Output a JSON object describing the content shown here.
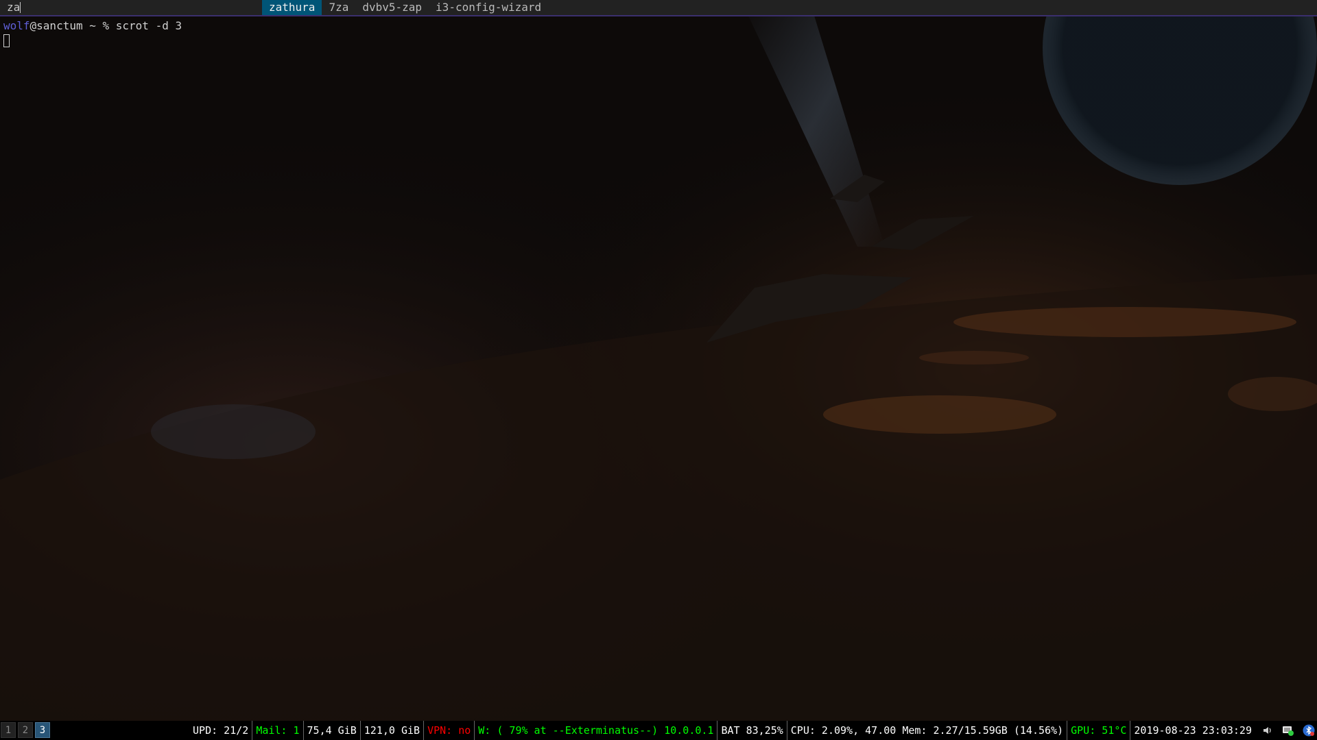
{
  "dmenu": {
    "input": "za",
    "items": [
      {
        "label": "zathura",
        "selected": true
      },
      {
        "label": "7za",
        "selected": false
      },
      {
        "label": "dvbv5-zap",
        "selected": false
      },
      {
        "label": "i3-config-wizard",
        "selected": false
      }
    ]
  },
  "terminal": {
    "user": "wolf",
    "host_part": "@sanctum ~ % ",
    "command": "scrot -d 3"
  },
  "i3bar": {
    "workspaces": [
      {
        "label": "1",
        "focused": false
      },
      {
        "label": "2",
        "focused": false
      },
      {
        "label": "3",
        "focused": true
      }
    ],
    "status": {
      "updates": "UPD: 21/2",
      "mail": "Mail: 1",
      "disk1": "75,4 GiB",
      "disk2": "121,0 GiB",
      "vpn": "VPN: no",
      "wifi": "W: ( 79% at --Exterminatus--) 10.0.0.1",
      "battery": "BAT 83,25%",
      "cpu_mem": "CPU: 2.09%, 47.00 Mem: 2.27/15.59GB (14.56%)",
      "gpu": "GPU: 51°C",
      "datetime": "2019-08-23 23:03:29"
    },
    "tray": [
      "volume-icon",
      "network-manager-icon",
      "bluetooth-icon"
    ]
  },
  "colors": {
    "dmenu_selected_bg": "#005577",
    "good": "#00ff00",
    "bad": "#ff0000",
    "workspace_focused": "#285577",
    "prompt_user": "#5f5fd7"
  }
}
